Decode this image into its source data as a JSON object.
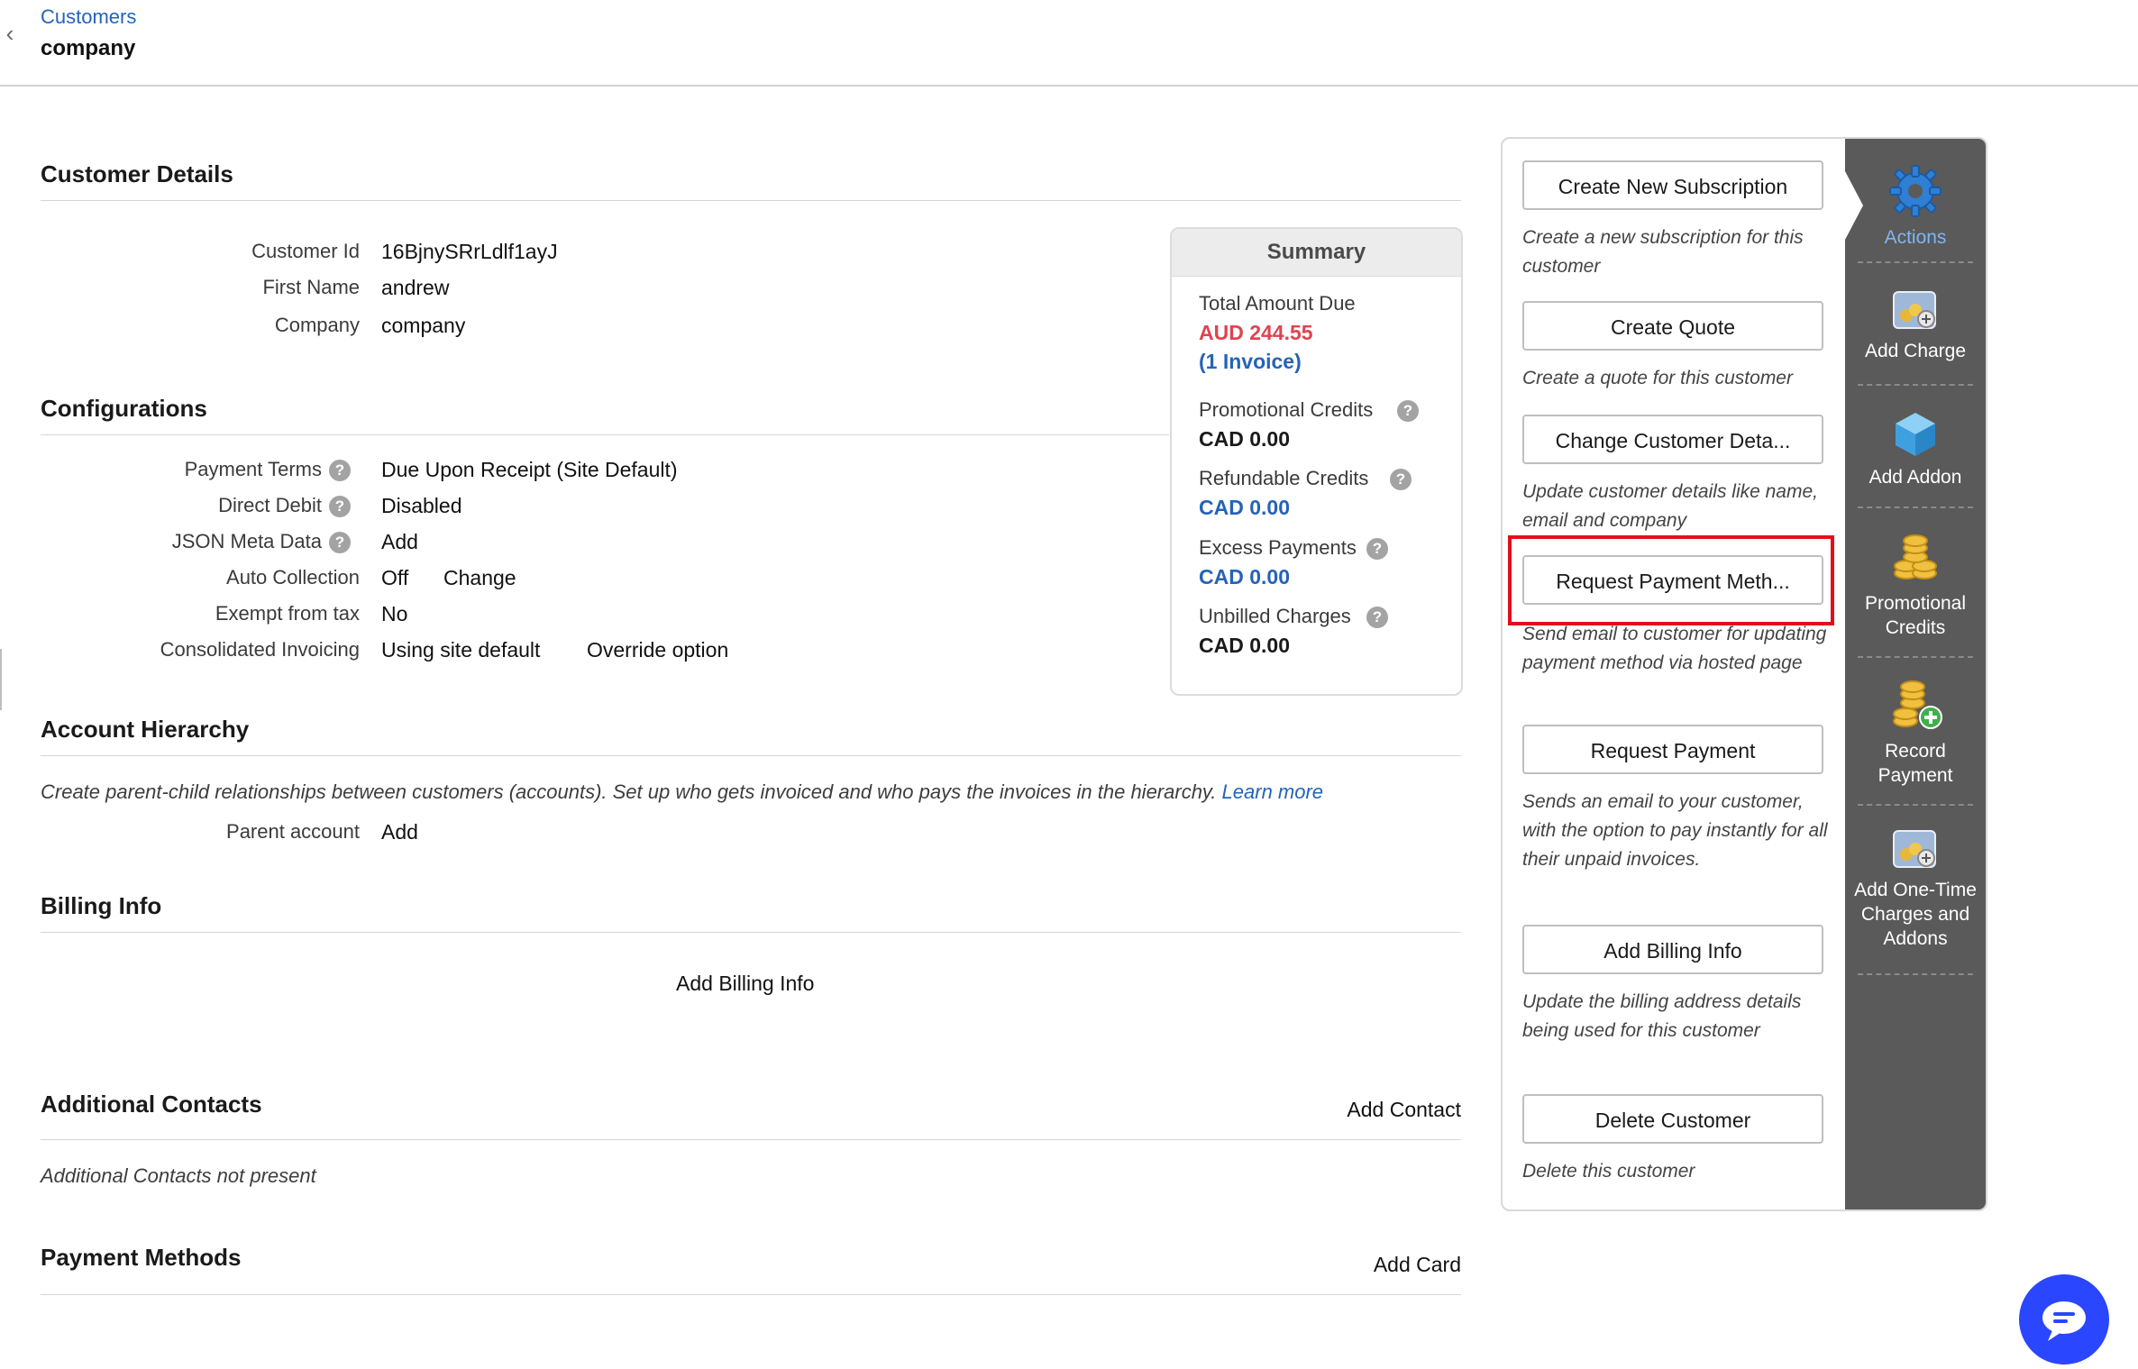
{
  "header": {
    "breadcrumb": "Customers",
    "title": "company"
  },
  "customer_details": {
    "heading": "Customer Details",
    "fields": [
      {
        "label": "Customer Id",
        "value": "16BjnySRrLdlf1ayJ"
      },
      {
        "label": "First Name",
        "value": "andrew"
      },
      {
        "label": "Company",
        "value": "company"
      }
    ]
  },
  "configurations": {
    "heading": "Configurations",
    "payment_terms": {
      "label": "Payment Terms",
      "value": "Due Upon Receipt (Site Default)"
    },
    "direct_debit": {
      "label": "Direct Debit",
      "value": "Disabled"
    },
    "json_meta": {
      "label": "JSON Meta Data",
      "action": "Add"
    },
    "auto_collection": {
      "label": "Auto Collection",
      "value": "Off",
      "action": "Change"
    },
    "exempt_tax": {
      "label": "Exempt from tax",
      "value": "No"
    },
    "consolidated": {
      "label": "Consolidated Invoicing",
      "value": "Using site default",
      "action": "Override option"
    }
  },
  "summary": {
    "title": "Summary",
    "total_label": "Total Amount Due",
    "total_value": "AUD 244.55",
    "invoice_count": "(1 Invoice)",
    "promo_label": "Promotional Credits",
    "promo_value": "CAD 0.00",
    "refund_label": "Refundable Credits",
    "refund_value": "CAD 0.00",
    "excess_label": "Excess Payments",
    "excess_value": "CAD 0.00",
    "unbilled_label": "Unbilled Charges",
    "unbilled_value": "CAD 0.00"
  },
  "account_hierarchy": {
    "heading": "Account Hierarchy",
    "description": "Create parent-child relationships between customers (accounts). Set up who gets invoiced and who pays the invoices in the hierarchy.",
    "learn_more": "Learn more",
    "parent_label": "Parent account",
    "parent_action": "Add"
  },
  "billing_info": {
    "heading": "Billing Info",
    "action": "Add Billing Info"
  },
  "additional_contacts": {
    "heading": "Additional Contacts",
    "action": "Add Contact",
    "empty": "Additional Contacts not present"
  },
  "payment_methods": {
    "heading": "Payment Methods",
    "action": "Add Card"
  },
  "actions": [
    {
      "label": "Create New Subscription",
      "desc": "Create a new subscription for this customer"
    },
    {
      "label": "Create Quote",
      "desc": "Create a quote for this customer"
    },
    {
      "label": "Change Customer Deta...",
      "desc": "Update customer details like name, email and company"
    },
    {
      "label": "Request Payment Meth...",
      "desc": "Send email to customer for updating payment method via hosted page"
    },
    {
      "label": "Request Payment",
      "desc": "Sends an email to your customer, with the option to pay instantly for all their unpaid invoices."
    },
    {
      "label": "Add Billing Info",
      "desc": "Update the billing address details being used for this customer"
    },
    {
      "label": "Delete Customer",
      "desc": "Delete this customer"
    }
  ],
  "rail": [
    {
      "label": "Actions",
      "icon": "gear-icon"
    },
    {
      "label": "Add Charge",
      "icon": "add-charge-icon"
    },
    {
      "label": "Add Addon",
      "icon": "addon-cube-icon"
    },
    {
      "label": "Promotional Credits",
      "icon": "coins-icon"
    },
    {
      "label": "Record Payment",
      "icon": "coins-plus-icon"
    },
    {
      "label": "Add One-Time Charges and Addons",
      "icon": "one-time-charge-icon"
    }
  ],
  "colors": {
    "link": "#2563b8",
    "due_red": "#e0434f",
    "rail": "#5a5a5a",
    "highlight": "#e0101a",
    "chat": "#2b46ff"
  }
}
